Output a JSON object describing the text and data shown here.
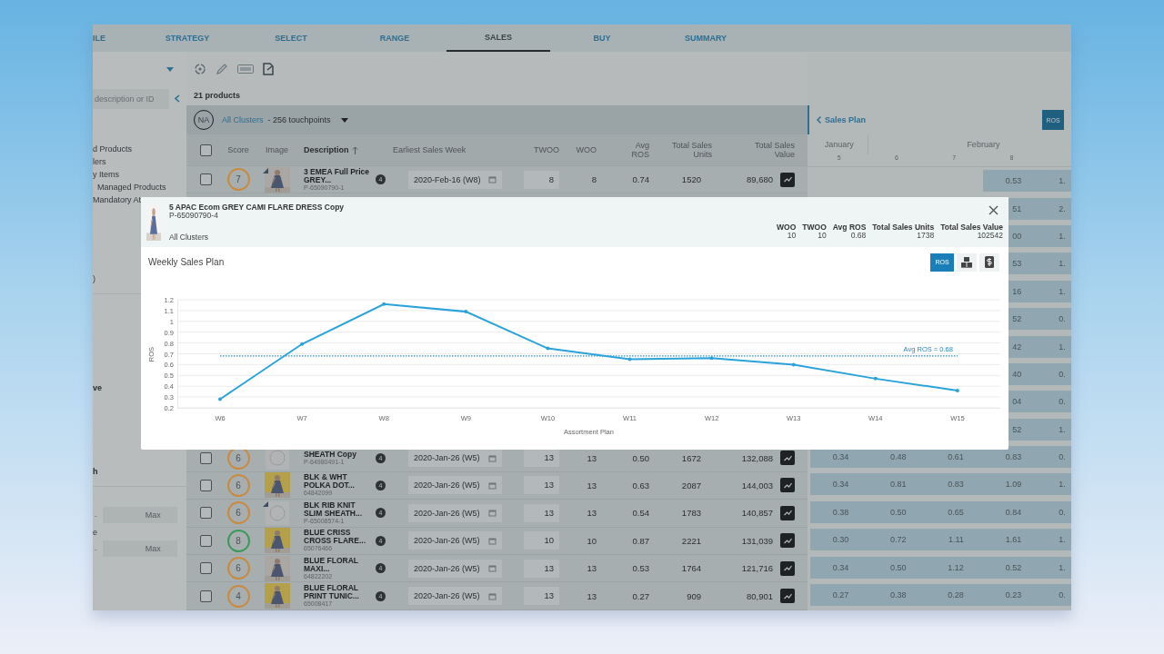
{
  "tabs": [
    {
      "label": "ILE",
      "selected": false
    },
    {
      "label": "STRATEGY",
      "selected": false
    },
    {
      "label": "SELECT",
      "selected": false
    },
    {
      "label": "RANGE",
      "selected": false
    },
    {
      "label": "SALES",
      "selected": true
    },
    {
      "label": "BUY",
      "selected": false
    },
    {
      "label": "SUMMARY",
      "selected": false
    }
  ],
  "sidebar": {
    "search": {
      "placeholder": "description or ID"
    },
    "items": [
      "d Products",
      "lers",
      "y Items",
      "Managed Products",
      "Mandatory At"
    ],
    "filters": [
      {
        "kind": "text",
        "text": ")"
      },
      {
        "kind": "heading",
        "text": "ve"
      },
      {
        "kind": "heading",
        "text": "h"
      },
      {
        "kind": "range",
        "dash": "-",
        "max": "Max"
      },
      {
        "kind": "text",
        "text": "e"
      },
      {
        "kind": "range",
        "dash": "-",
        "max": "Max"
      }
    ]
  },
  "product_count": "21 products",
  "cluster": {
    "avatar": "NA",
    "name": "All Clusters",
    "touchpoints": "- 256 touchpoints"
  },
  "table": {
    "select_all_checked": false,
    "columns": [
      {
        "label": "Score"
      },
      {
        "label": "Image"
      },
      {
        "label": "Description",
        "sorted_ascending": true
      },
      {
        "label": "Earliest Sales Week"
      },
      {
        "label": "TWOO"
      },
      {
        "label": "WOO"
      },
      {
        "label": "Avg ROS"
      },
      {
        "label": "Total Sales Units"
      },
      {
        "label": "Total Sales Value"
      }
    ],
    "rows_above": [
      {
        "checked": false,
        "score": "7",
        "color": "#c98a3f",
        "flagged": true,
        "description": "3 EMEA Full Price GREY...",
        "id": "P-65090790-1",
        "badge": "4",
        "week": "2020-Feb-16 (W8)",
        "twoo": "8",
        "woo": "8",
        "avg_ros": "0.74",
        "units": "1520",
        "value": "89,680"
      }
    ],
    "rows_below": [
      {
        "checked": false,
        "score": "6",
        "color": "#c98a3f",
        "thumbnail": {
          "kind": "placeholder"
        },
        "flagged": false,
        "description": "SHEATH Copy",
        "id": "P-64980491-1",
        "badge": "4",
        "week": "2020-Jan-26 (W5)",
        "twoo": "13",
        "woo": "13",
        "avg_ros": "0.50",
        "units": "1672",
        "value": "132,088"
      },
      {
        "checked": false,
        "score": "6",
        "color": "#c98a3f",
        "flagged": false,
        "description": "BLK & WHT POLKA DOT...",
        "id": "64842099",
        "badge": "4",
        "week": "2020-Jan-26 (W5)",
        "twoo": "13",
        "woo": "13",
        "avg_ros": "0.63",
        "units": "2087",
        "value": "144,003"
      },
      {
        "checked": false,
        "score": "6",
        "color": "#c98a3f",
        "thumbnail": {
          "kind": "placeholder"
        },
        "flagged": true,
        "description": "BLK RIB KNIT SLIM SHEATH...",
        "id": "P-65008574-1",
        "badge": "4",
        "week": "2020-Jan-26 (W5)",
        "twoo": "13",
        "woo": "13",
        "avg_ros": "0.54",
        "units": "1783",
        "value": "140,857"
      },
      {
        "checked": false,
        "score": "8",
        "color": "#3a9a5a",
        "flagged": false,
        "description": "BLUE CRISS CROSS FLARE...",
        "id": "65076466",
        "badge": "4",
        "week": "2020-Jan-26 (W5)",
        "twoo": "10",
        "woo": "10",
        "avg_ros": "0.87",
        "units": "2221",
        "value": "131,039"
      },
      {
        "checked": false,
        "score": "6",
        "color": "#c98a3f",
        "flagged": false,
        "description": "BLUE FLORAL MAXI...",
        "id": "64822202",
        "badge": "4",
        "week": "2020-Jan-26 (W5)",
        "twoo": "13",
        "woo": "13",
        "avg_ros": "0.53",
        "units": "1764",
        "value": "121,716"
      },
      {
        "checked": false,
        "score": "4",
        "color": "#c98a3f",
        "flagged": false,
        "description": "BLUE FLORAL PRINT TUNIC...",
        "id": "65008417",
        "badge": "4",
        "week": "2020-Jan-26 (W5)",
        "twoo": "13",
        "woo": "13",
        "avg_ros": "0.27",
        "units": "909",
        "value": "80,901"
      }
    ]
  },
  "sales_plan": {
    "title": "Sales Plan",
    "toggle": "ROS",
    "months": [
      {
        "label": "January",
        "weeks": [
          "5"
        ]
      },
      {
        "label": "February",
        "weeks": [
          "6",
          "7",
          "8"
        ]
      }
    ],
    "rows": [
      {
        "w8": "0.53",
        "w9": "1."
      },
      {
        "w8": "51",
        "w9": "2."
      },
      {
        "w8": "00",
        "w9": "1."
      },
      {
        "w8": "53",
        "w9": "1."
      },
      {
        "w8": "16",
        "w9": "1."
      },
      {
        "w8": "52",
        "w9": "0."
      },
      {
        "w8": "42",
        "w9": "1."
      },
      {
        "w8": "40",
        "w9": "0."
      },
      {
        "w8": "04",
        "w9": "0."
      },
      {
        "w8": "52",
        "w9": "1."
      },
      {
        "w5": "0.34",
        "w6": "0.48",
        "w7": "0.61",
        "w8": "0.83",
        "w9": "0."
      },
      {
        "w5": "0.34",
        "w6": "0.81",
        "w7": "0.83",
        "w8": "1.09",
        "w9": "1."
      },
      {
        "w5": "0.38",
        "w6": "0.50",
        "w7": "0.65",
        "w8": "0.84",
        "w9": "0."
      },
      {
        "w5": "0.30",
        "w6": "0.72",
        "w7": "1.11",
        "w8": "1.61",
        "w9": "1."
      },
      {
        "w5": "0.34",
        "w6": "0.50",
        "w7": "1.12",
        "w8": "0.52",
        "w9": "1."
      },
      {
        "w5": "0.27",
        "w6": "0.38",
        "w7": "0.28",
        "w8": "0.23",
        "w9": "0."
      }
    ]
  },
  "dialog": {
    "product": {
      "title": "5 APAC Ecom GREY CAMI FLARE DRESS Copy",
      "id": "P-65090790-4",
      "cluster": "All Clusters"
    },
    "stats": [
      {
        "label": "WOO",
        "value": "10"
      },
      {
        "label": "TWOO",
        "value": "10"
      },
      {
        "label": "Avg ROS",
        "value": "0.68"
      },
      {
        "label": "Total Sales Units",
        "value": "1738"
      },
      {
        "label": "Total Sales Value",
        "value": "102542"
      }
    ],
    "section_title": "Weekly Sales Plan",
    "views": [
      {
        "kind": "ros",
        "label": "ROS",
        "selected": true
      },
      {
        "kind": "units",
        "selected": false
      },
      {
        "kind": "value",
        "selected": false
      }
    ],
    "chart_data": {
      "type": "line",
      "xlabel": "Assortment Plan",
      "ylabel": "ROS",
      "grid": true,
      "categories": [
        "W6",
        "W7",
        "W8",
        "W9",
        "W10",
        "W11",
        "W12",
        "W13",
        "W14",
        "W15"
      ],
      "series": [
        {
          "color": "#29a3d9",
          "values": [
            0.28,
            0.79,
            1.16,
            1.09,
            0.75,
            0.65,
            0.66,
            0.6,
            0.47,
            0.36
          ]
        }
      ],
      "ylim": [
        0.2,
        1.2
      ],
      "yticks": [
        0.2,
        0.3,
        0.4,
        0.5,
        0.6,
        0.7,
        0.8,
        0.9,
        1.0,
        1.1,
        1.2
      ],
      "ref_lines": [
        {
          "axis": "y",
          "value": 0.68,
          "label": "Avg ROS = 0.68"
        }
      ]
    }
  }
}
